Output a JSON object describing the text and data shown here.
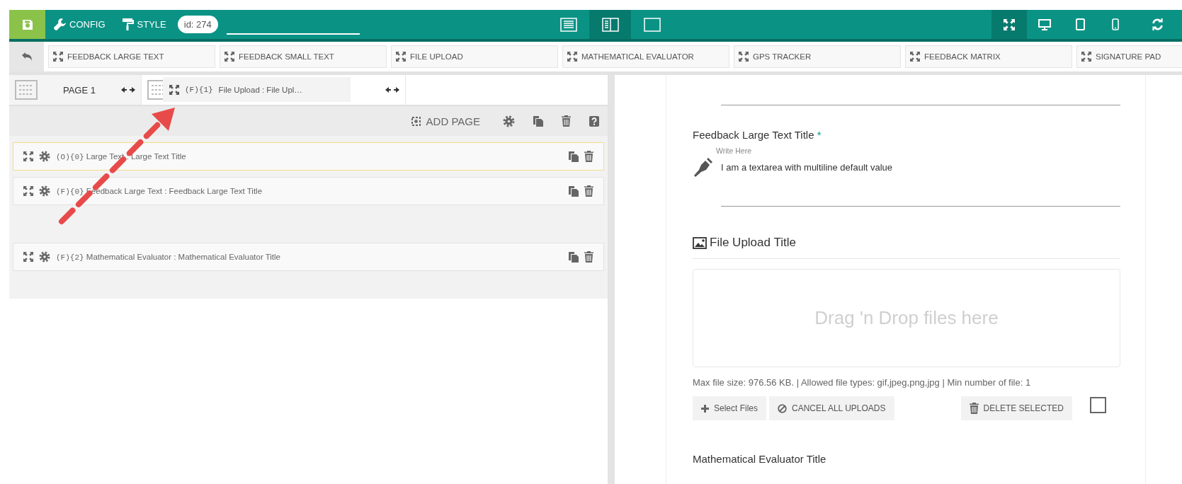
{
  "header": {
    "config": "CONFIG",
    "style": "STYLE",
    "id_badge": "id: 274",
    "view_modes": [
      {
        "kind": "list",
        "selected": false
      },
      {
        "kind": "split",
        "selected": true
      },
      {
        "kind": "blank",
        "selected": false
      }
    ],
    "devices": [
      {
        "kind": "fullscreen",
        "selected": true
      },
      {
        "kind": "desktop",
        "selected": false
      },
      {
        "kind": "tablet",
        "selected": false
      },
      {
        "kind": "phone",
        "selected": false
      }
    ]
  },
  "components": [
    "FEEDBACK LARGE TEXT",
    "FEEDBACK SMALL TEXT",
    "FILE UPLOAD",
    "MATHEMATICAL EVALUATOR",
    "GPS TRACKER",
    "FEEDBACK MATRIX",
    "SIGNATURE PAD"
  ],
  "pages": [
    {
      "label": "PAGE 1",
      "selected": false
    },
    {
      "selected": true
    }
  ],
  "drag_ghost": {
    "code": "(F){1}",
    "label": "File Upload : File Upl…"
  },
  "page_actions": {
    "add_page": "ADD PAGE"
  },
  "fields": [
    {
      "kind": "field",
      "code": "(O){0}",
      "label": "Large Text : Large Text Title",
      "highlighted": true
    },
    {
      "kind": "field",
      "code": "(F){0}",
      "label": "Feedback Large Text : Feedback Large Text Title",
      "highlighted": false
    },
    {
      "kind": "placeholder"
    },
    {
      "kind": "field",
      "code": "(F){2}",
      "label": "Mathematical Evaluator : Mathematical Evaluator Title",
      "highlighted": false
    }
  ],
  "preview": {
    "textarea": {
      "label": "Feedback Large Text Title",
      "required": true,
      "required_mark": "*",
      "floating_label": "Write Here",
      "value": "I am a textarea with multiline default value"
    },
    "file_upload": {
      "title": "File Upload Title",
      "dropzone": "Drag 'n Drop files here",
      "info": "Max file size: 976.56 KB. | Allowed file types: gif,jpeg,png,jpg | Min number of file: 1",
      "buttons": [
        {
          "kind": "add",
          "label": "Select Files"
        },
        {
          "kind": "cancel",
          "label": "CANCEL ALL UPLOADS"
        },
        {
          "kind": "delete",
          "label": "DELETE SELECTED"
        }
      ],
      "checked": false
    },
    "math": {
      "title": "Mathematical Evaluator Title"
    }
  }
}
